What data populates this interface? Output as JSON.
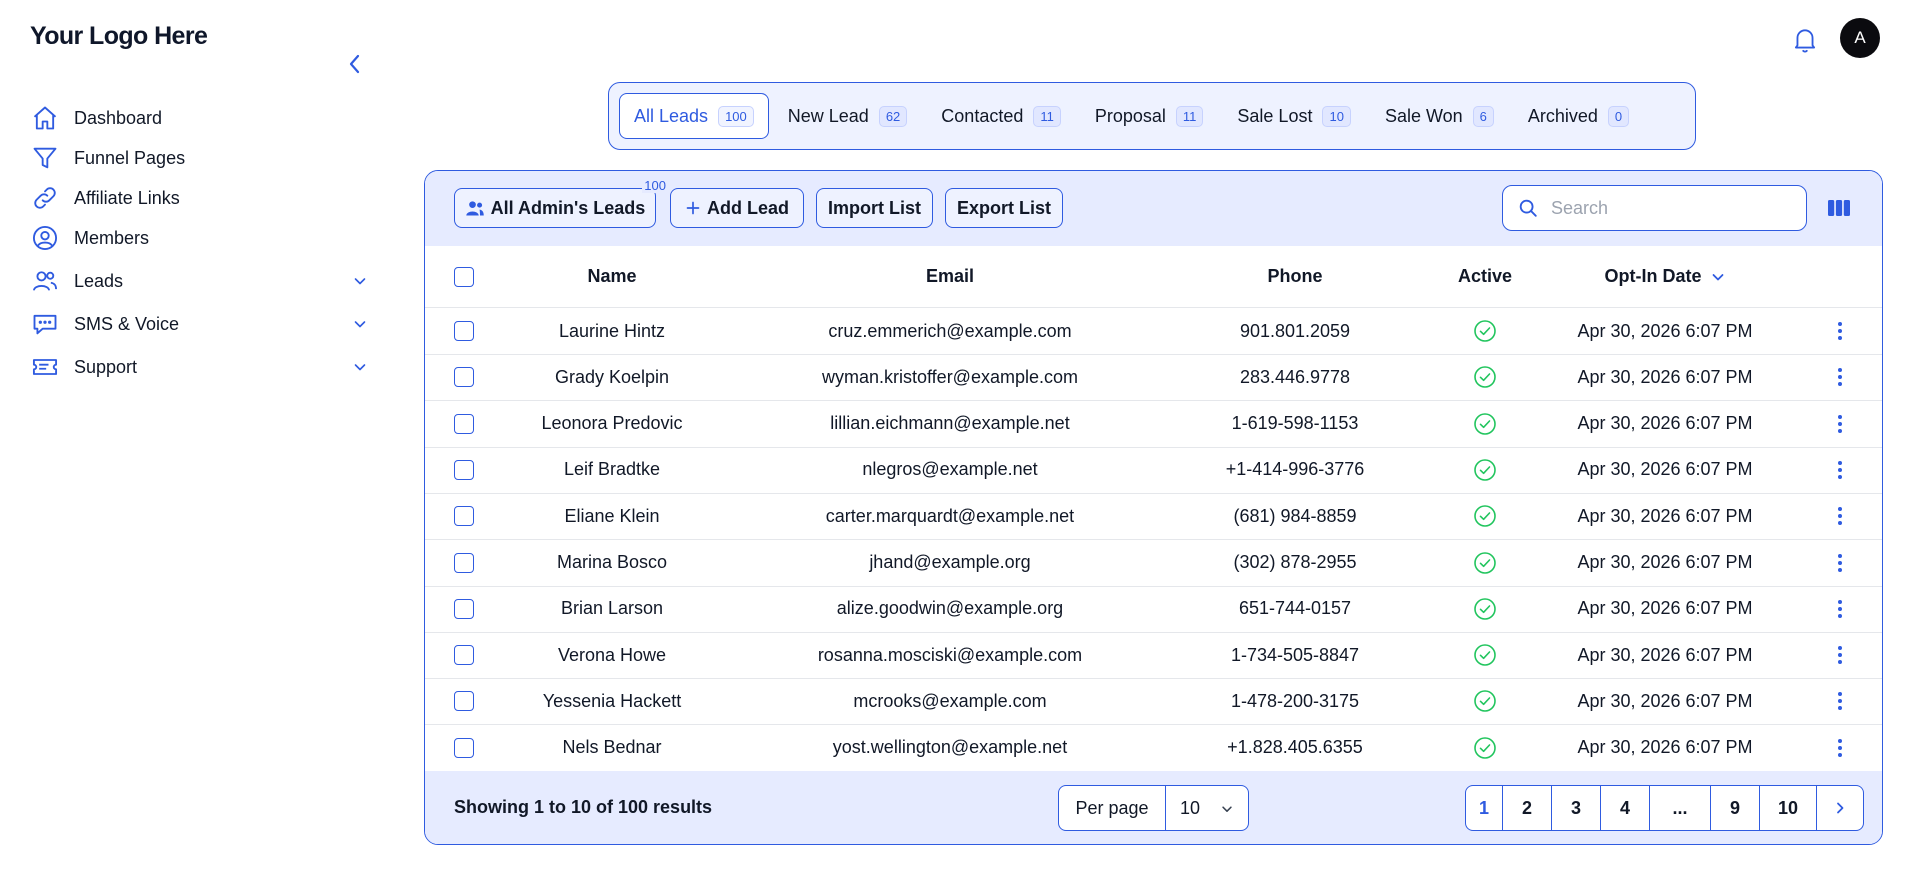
{
  "brand": {
    "logo_text": "Your Logo Here"
  },
  "sidebar": {
    "items": [
      {
        "label": "Dashboard",
        "icon": "home-icon"
      },
      {
        "label": "Funnel Pages",
        "icon": "funnel-icon"
      },
      {
        "label": "Affiliate Links",
        "icon": "link-icon"
      },
      {
        "label": "Members",
        "icon": "user-circle-icon"
      },
      {
        "label": "Leads",
        "icon": "users-icon",
        "expandable": true
      },
      {
        "label": "SMS & Voice",
        "icon": "chat-icon",
        "expandable": true
      },
      {
        "label": "Support",
        "icon": "ticket-icon",
        "expandable": true
      }
    ]
  },
  "header": {
    "avatar_initial": "A"
  },
  "tabs": [
    {
      "label": "All Leads",
      "count": "100",
      "active": true
    },
    {
      "label": "New Lead",
      "count": "62"
    },
    {
      "label": "Contacted",
      "count": "11"
    },
    {
      "label": "Proposal",
      "count": "11"
    },
    {
      "label": "Sale Lost",
      "count": "10"
    },
    {
      "label": "Sale Won",
      "count": "6"
    },
    {
      "label": "Archived",
      "count": "0"
    }
  ],
  "toolbar": {
    "admin_leads_label": "All Admin's Leads",
    "admin_leads_count": "100",
    "add_lead_label": "Add Lead",
    "import_label": "Import List",
    "export_label": "Export List",
    "search_placeholder": "Search"
  },
  "table": {
    "columns": {
      "name": "Name",
      "email": "Email",
      "phone": "Phone",
      "active": "Active",
      "optin": "Opt-In Date"
    },
    "rows": [
      {
        "name": "Laurine Hintz",
        "email": "cruz.emmerich@example.com",
        "phone": "901.801.2059",
        "active": true,
        "date": "Apr 30, 2026 6:07 PM"
      },
      {
        "name": "Grady Koelpin",
        "email": "wyman.kristoffer@example.com",
        "phone": "283.446.9778",
        "active": true,
        "date": "Apr 30, 2026 6:07 PM"
      },
      {
        "name": "Leonora Predovic",
        "email": "lillian.eichmann@example.net",
        "phone": "1-619-598-1153",
        "active": true,
        "date": "Apr 30, 2026 6:07 PM"
      },
      {
        "name": "Leif Bradtke",
        "email": "nlegros@example.net",
        "phone": "+1-414-996-3776",
        "active": true,
        "date": "Apr 30, 2026 6:07 PM"
      },
      {
        "name": "Eliane Klein",
        "email": "carter.marquardt@example.net",
        "phone": "(681) 984-8859",
        "active": true,
        "date": "Apr 30, 2026 6:07 PM"
      },
      {
        "name": "Marina Bosco",
        "email": "jhand@example.org",
        "phone": "(302) 878-2955",
        "active": true,
        "date": "Apr 30, 2026 6:07 PM"
      },
      {
        "name": "Brian Larson",
        "email": "alize.goodwin@example.org",
        "phone": "651-744-0157",
        "active": true,
        "date": "Apr 30, 2026 6:07 PM"
      },
      {
        "name": "Verona Howe",
        "email": "rosanna.mosciski@example.com",
        "phone": "1-734-505-8847",
        "active": true,
        "date": "Apr 30, 2026 6:07 PM"
      },
      {
        "name": "Yessenia Hackett",
        "email": "mcrooks@example.com",
        "phone": "1-478-200-3175",
        "active": true,
        "date": "Apr 30, 2026 6:07 PM"
      },
      {
        "name": "Nels Bednar",
        "email": "yost.wellington@example.net",
        "phone": "+1.828.405.6355",
        "active": true,
        "date": "Apr 30, 2026 6:07 PM"
      }
    ]
  },
  "footer": {
    "showing_text": "Showing 1 to 10 of 100 results",
    "per_page_label": "Per page",
    "per_page_value": "10",
    "pages": [
      "1",
      "2",
      "3",
      "4",
      "...",
      "9",
      "10"
    ],
    "current_page": "1"
  },
  "colors": {
    "accent": "#2f5be0",
    "panel": "#e6ebff",
    "active_check": "#22c55e"
  }
}
